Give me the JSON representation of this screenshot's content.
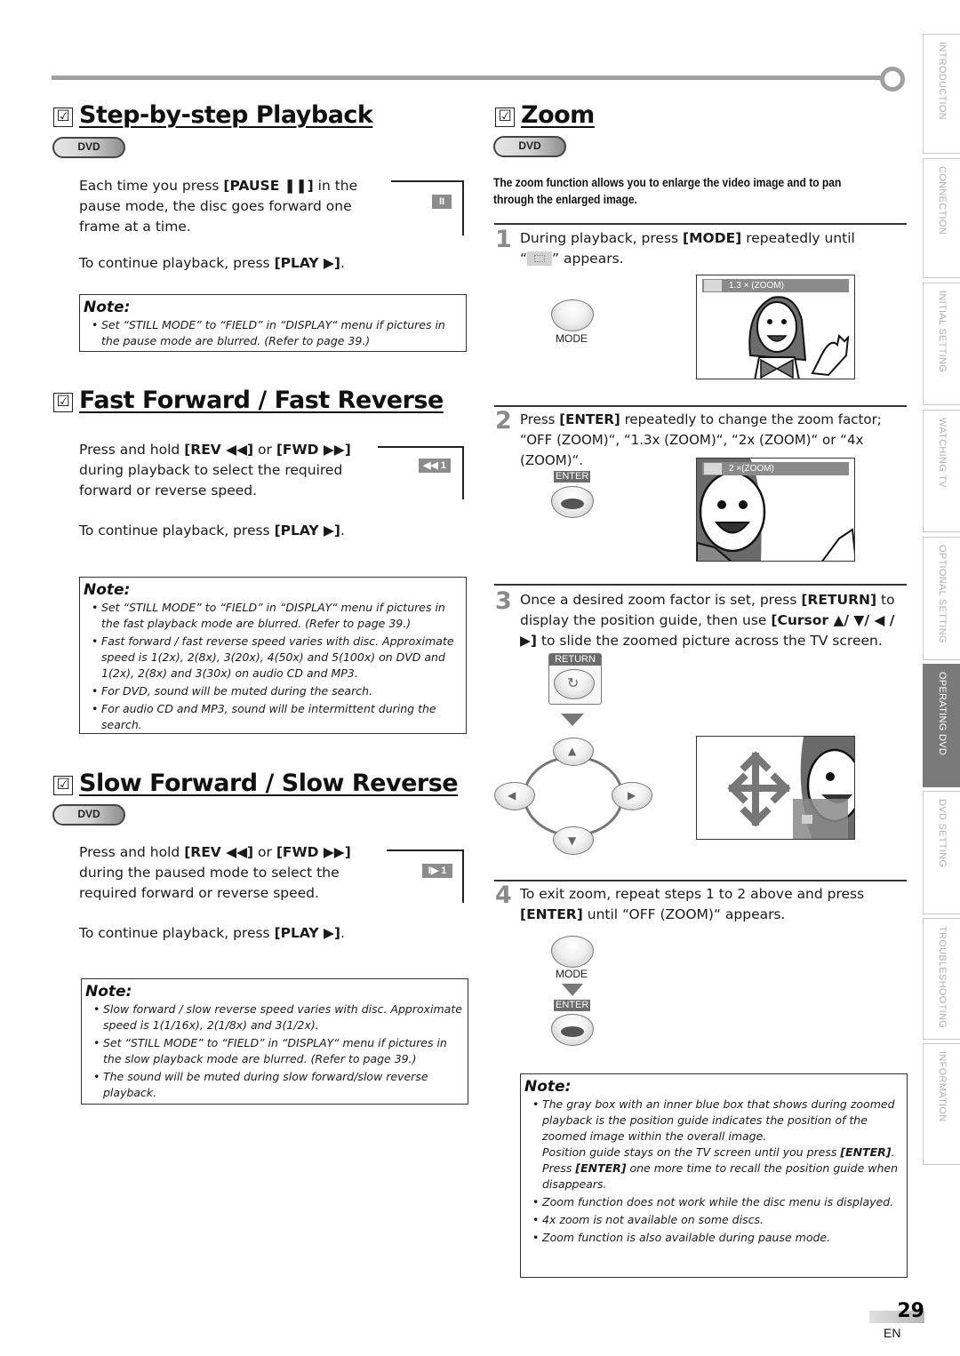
{
  "side_tabs": [
    {
      "label": "INTRODUCTION",
      "active": false
    },
    {
      "label": "CONNECTION",
      "active": false
    },
    {
      "label": "INITIAL  SETTING",
      "active": false
    },
    {
      "label": "WATCHING  TV",
      "active": false
    },
    {
      "label": "OPTIONAL  SETTING",
      "active": false
    },
    {
      "label": "OPERATING  DVD",
      "active": true
    },
    {
      "label": "DVD  SETTING",
      "active": false
    },
    {
      "label": "TROUBLESHOOTING",
      "active": false
    },
    {
      "label": "INFORMATION",
      "active": false
    }
  ],
  "checkbox_glyph": "☑",
  "badge_label": "DVD",
  "note_title": "Note:",
  "step_by_step": {
    "title": "Step-by-step Playback",
    "para_pre": "Each time you press ",
    "para_key": "[PAUSE ❚❚]",
    "para_post": " in the pause mode, the disc goes forward one frame at a time.",
    "continue_pre": "To continue playback, press ",
    "continue_key": "[PLAY ▶]",
    "continue_post": ".",
    "osd": "II",
    "notes": [
      "Set “STILL MODE” to “FIELD” in “DISPLAY“ menu if pictures in the pause mode are blurred. (Refer to page 39.)"
    ]
  },
  "fast": {
    "title": "Fast Forward / Fast Reverse",
    "para_pre": "Press and hold ",
    "key1": "[REV ◀◀]",
    "mid": " or ",
    "key2": "[FWD ▶▶]",
    "para_post": " during playback to select the required forward or reverse speed.",
    "continue_pre": "To continue playback, press ",
    "continue_key": "[PLAY ▶]",
    "continue_post": ".",
    "osd": "◀◀ 1",
    "notes": [
      "Set “STILL MODE” to “FIELD” in “DISPLAY“ menu if pictures in the fast playback mode are blurred. (Refer to page 39.)",
      "Fast forward / fast reverse speed varies with disc. Approximate speed is 1(2x), 2(8x), 3(20x), 4(50x) and 5(100x) on DVD and 1(2x), 2(8x) and 3(30x) on audio CD and MP3.",
      "For DVD, sound will be muted during the search.",
      "For audio CD and MP3, sound will be intermittent during the search."
    ]
  },
  "slow": {
    "title": "Slow Forward / Slow Reverse",
    "para_pre": "Press and hold ",
    "key1": "[REV ◀◀]",
    "mid": " or ",
    "key2": "[FWD ▶▶]",
    "para_post": " during the paused mode to select the required forward or reverse speed.",
    "continue_pre": "To continue playback, press ",
    "continue_key": "[PLAY ▶]",
    "continue_post": ".",
    "osd": "I▶ 1",
    "notes": [
      "Slow forward / slow reverse speed varies with disc. Approximate speed is 1(1/16x), 2(1/8x) and 3(1/2x).",
      "Set “STILL MODE”  to “FIELD” in “DISPLAY“ menu if pictures in the slow playback mode are blurred. (Refer to page 39.)",
      "The sound will be muted during slow forward/slow reverse playback."
    ]
  },
  "zoom": {
    "title": "Zoom",
    "intro": "The zoom function allows you to enlarge the video image and to pan through the enlarged image.",
    "steps": [
      {
        "num": "1",
        "pre": "During playback, press ",
        "key": "[MODE]",
        "post": " repeatedly until",
        "line2_pre": "“",
        "line2_post": "” appears."
      },
      {
        "num": "2",
        "pre": "Press ",
        "key": "[ENTER]",
        "post": " repeatedly to change the zoom factor; “OFF (ZOOM)“, “1.3x (ZOOM)“, “2x (ZOOM)“ or “4x (ZOOM)“."
      },
      {
        "num": "3",
        "pre": "Once a desired zoom factor is set, press ",
        "key": "[RETURN]",
        "post": " to display the position guide, then use ",
        "key2": "[Cursor ▲/ ▼/ ◀ / ▶]",
        "post2": " to slide the zoomed picture across the TV screen."
      },
      {
        "num": "4",
        "pre": "To exit zoom, repeat steps 1 to 2 above and press ",
        "key": "[ENTER]",
        "post": " until “OFF (ZOOM)“ appears."
      }
    ],
    "btn_mode": "MODE",
    "btn_enter": "ENTER",
    "btn_return": "RETURN",
    "tv1_label": "1.3 ×  (ZOOM)",
    "tv2_label": "2 ×(ZOOM)",
    "notes": [
      "The gray box with an inner blue box that shows during zoomed playback is the position guide indicates the position of the zoomed image within the overall image.",
      "Zoom function does not work while the disc menu is displayed.",
      "4x zoom is not available on some discs.",
      "Zoom function is also available during pause mode."
    ],
    "note1_extra_pre": "Position guide stays on the TV screen until you press ",
    "note1_extra_key": "[ENTER]",
    "note1_extra_mid": ". Press ",
    "note1_extra_key2": "[ENTER]",
    "note1_extra_post": " one more time to recall the position guide when disappears."
  },
  "page": {
    "number": "29",
    "lang": "EN"
  }
}
